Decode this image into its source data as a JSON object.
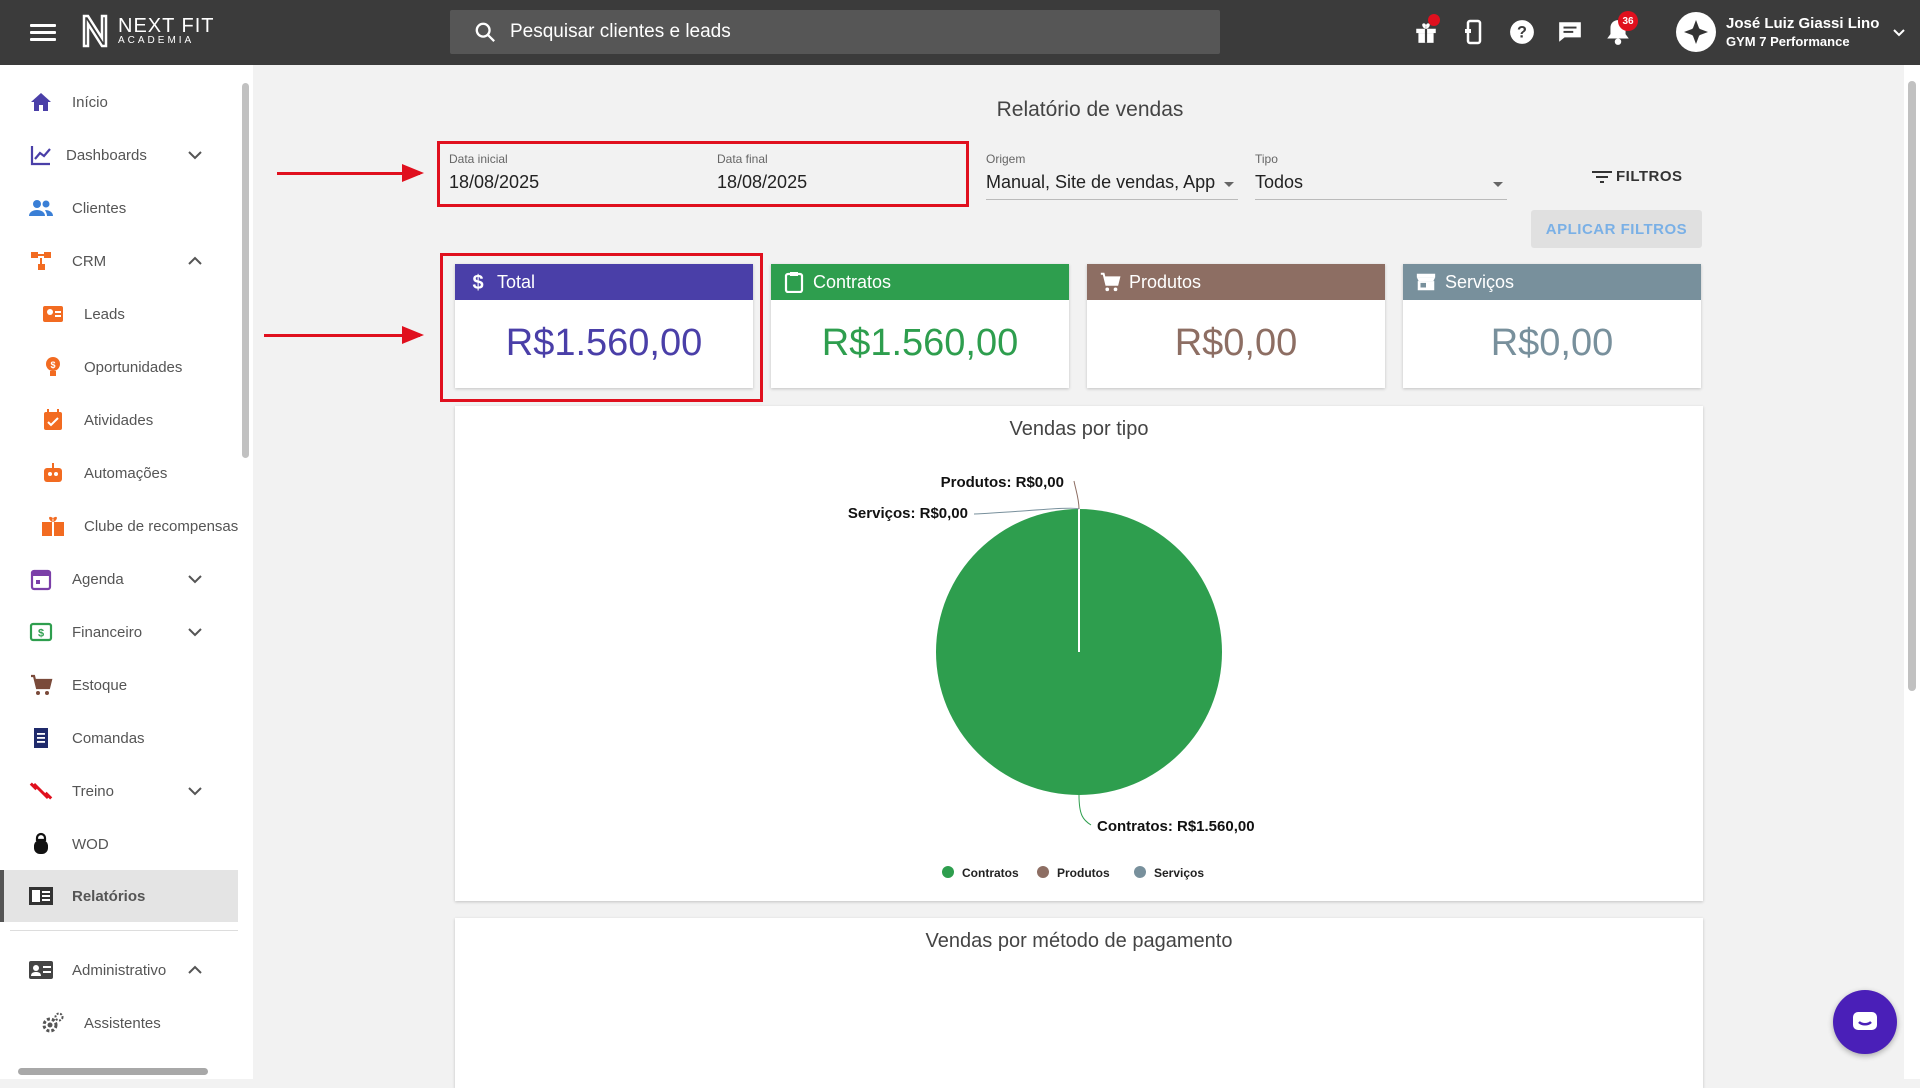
{
  "header": {
    "logo_line1": "NEXT FIT",
    "logo_line2": "ACADEMIA",
    "search_placeholder": "Pesquisar clientes e leads",
    "notification_count": "36",
    "user_name": "José Luiz Giassi Lino",
    "user_gym": "GYM 7 Performance"
  },
  "sidebar": {
    "items": [
      {
        "label": "Início",
        "icon": "home-icon"
      },
      {
        "label": "Dashboards",
        "icon": "chart-line-icon"
      },
      {
        "label": "Clientes",
        "icon": "people-icon"
      },
      {
        "label": "CRM",
        "icon": "crm-icon"
      },
      {
        "label": "Leads",
        "icon": "leads-icon"
      },
      {
        "label": "Oportunidades",
        "icon": "lightbulb-icon"
      },
      {
        "label": "Atividades",
        "icon": "calendar-check-icon"
      },
      {
        "label": "Automações",
        "icon": "robot-icon"
      },
      {
        "label": "Clube de recompensas",
        "icon": "gift-icon"
      },
      {
        "label": "Agenda",
        "icon": "calendar-icon"
      },
      {
        "label": "Financeiro",
        "icon": "money-icon"
      },
      {
        "label": "Estoque",
        "icon": "cart-icon"
      },
      {
        "label": "Comandas",
        "icon": "receipt-icon"
      },
      {
        "label": "Treino",
        "icon": "dumbbell-icon"
      },
      {
        "label": "WOD",
        "icon": "kettlebell-icon"
      },
      {
        "label": "Relatórios",
        "icon": "report-icon"
      },
      {
        "label": "Administrativo",
        "icon": "id-card-icon"
      },
      {
        "label": "Assistentes",
        "icon": "gears-icon"
      }
    ]
  },
  "report": {
    "title": "Relatório de vendas",
    "date_start_label": "Data inicial",
    "date_start_value": "18/08/2025",
    "date_end_label": "Data final",
    "date_end_value": "18/08/2025",
    "origem_label": "Origem",
    "origem_value": "Manual, Site de vendas, App...",
    "tipo_label": "Tipo",
    "tipo_value": "Todos",
    "filtros_label": "FILTROS",
    "aplicar_label": "APLICAR FILTROS"
  },
  "cards": [
    {
      "label": "Total",
      "value": "R$1.560,00",
      "color": "#4a3fa8"
    },
    {
      "label": "Contratos",
      "value": "R$1.560,00",
      "color": "#2e9e4e"
    },
    {
      "label": "Produtos",
      "value": "R$0,00",
      "color": "#8d6e63"
    },
    {
      "label": "Serviços",
      "value": "R$0,00",
      "color": "#78909c"
    }
  ],
  "chart_data": {
    "type": "pie",
    "title": "Vendas por tipo",
    "categories": [
      "Contratos",
      "Produtos",
      "Serviços"
    ],
    "values": [
      1560,
      0,
      0
    ],
    "data_labels": [
      "Contratos: R$1.560,00",
      "Produtos: R$0,00",
      "Serviços: R$0,00"
    ],
    "colors": [
      "#2e9e4e",
      "#8d6e63",
      "#78909c"
    ],
    "legend_position": "bottom"
  },
  "panel2_title": "Vendas por método de pagamento"
}
